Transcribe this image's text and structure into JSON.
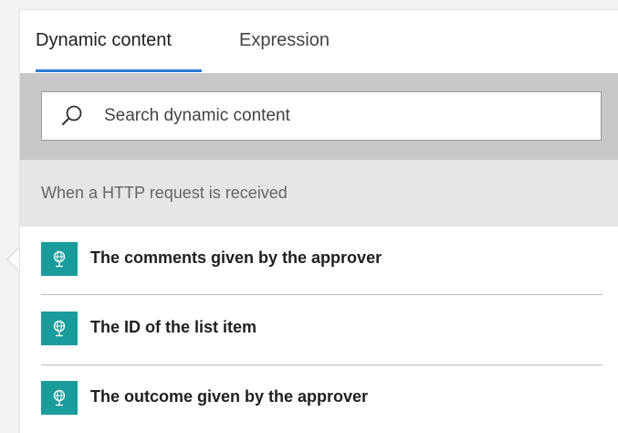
{
  "tabs": [
    {
      "label": "Dynamic content",
      "active": true
    },
    {
      "label": "Expression",
      "active": false
    }
  ],
  "search": {
    "placeholder": "Search dynamic content",
    "value": ""
  },
  "section": {
    "title": "When a HTTP request is received"
  },
  "items": [
    {
      "label": "The comments given by the approver",
      "icon": "request-globe-icon"
    },
    {
      "label": "The ID of the list item",
      "icon": "request-globe-icon"
    },
    {
      "label": "The outcome given by the approver",
      "icon": "request-globe-icon"
    }
  ],
  "colors": {
    "accent": "#2b7cd3",
    "item_icon_bg": "#1b9c9c",
    "search_band": "#c8c8c8",
    "section_bg": "#e6e6e6"
  }
}
